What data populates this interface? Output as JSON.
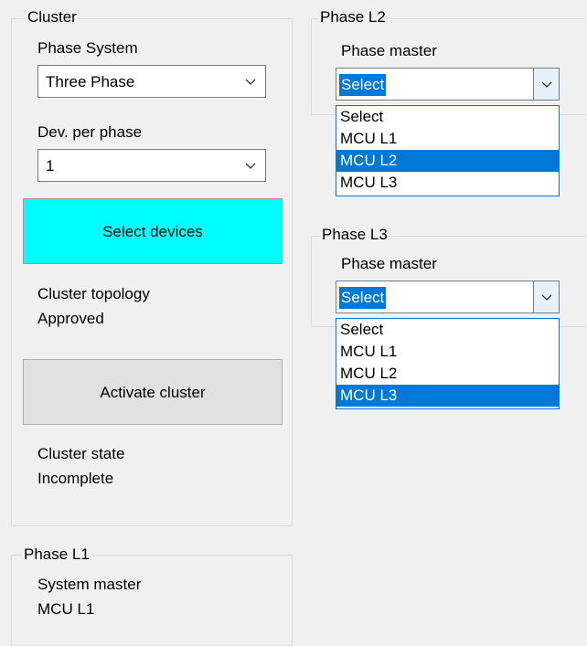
{
  "cluster": {
    "title": "Cluster",
    "phase_system_label": "Phase System",
    "phase_system_value": "Three Phase",
    "dev_per_phase_label": "Dev. per phase",
    "dev_per_phase_value": "1",
    "select_devices_label": "Select devices",
    "topology_label": "Cluster topology",
    "topology_value": "Approved",
    "activate_label": "Activate cluster",
    "state_label": "Cluster state",
    "state_value": "Incomplete"
  },
  "phase_l1": {
    "title": "Phase L1",
    "system_master_label": "System master",
    "system_master_value": "MCU L1"
  },
  "phase_l2": {
    "title": "Phase L2",
    "master_label": "Phase master",
    "selected": "Select",
    "options": [
      "Select",
      "MCU L1",
      "MCU L2",
      "MCU L3"
    ],
    "highlighted_index": 2
  },
  "phase_l3": {
    "title": "Phase L3",
    "master_label": "Phase master",
    "selected": "Select",
    "options": [
      "Select",
      "MCU L1",
      "MCU L2",
      "MCU L3"
    ],
    "highlighted_index": 3
  },
  "colors": {
    "select_devices_bg": "#00ffff",
    "highlight": "#0078d7",
    "activate_bg": "#e1e1e1"
  },
  "icons": {
    "combo_arrow": "chevron-down-icon"
  }
}
